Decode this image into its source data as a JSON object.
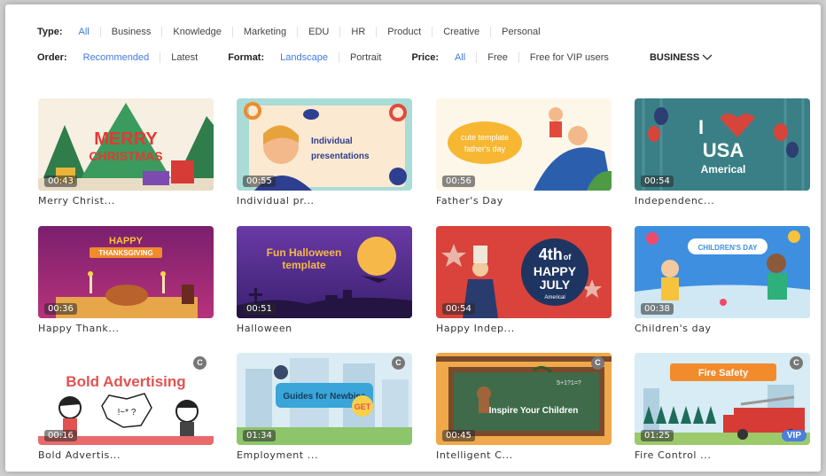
{
  "filters": {
    "type": {
      "label": "Type:",
      "options": [
        "All",
        "Business",
        "Knowledge",
        "Marketing",
        "EDU",
        "HR",
        "Product",
        "Creative",
        "Personal"
      ]
    },
    "order": {
      "label": "Order:",
      "options": [
        "Recommended",
        "Latest"
      ]
    },
    "format": {
      "label": "Format:",
      "options": [
        "Landscape",
        "Portrait"
      ]
    },
    "price": {
      "label": "Price:",
      "options": [
        "All",
        "Free",
        "Free for VIP users"
      ]
    },
    "category_dropdown": {
      "label": "BUSINESS",
      "icon": "chevron-down-icon"
    }
  },
  "colors": {
    "accent": "#3f7bdc",
    "vip": "#4a7ee0"
  },
  "templates": [
    {
      "title": "Merry Christ...",
      "duration": "00:43",
      "thumb_text": [
        "MERRY",
        "CHRISTMAS"
      ]
    },
    {
      "title": "Individual pr...",
      "duration": "00:55",
      "thumb_text": [
        "Individual",
        "presentations"
      ]
    },
    {
      "title": "Father's Day",
      "duration": "00:56",
      "thumb_text": [
        "cute template",
        "father's day"
      ]
    },
    {
      "title": "Independenc...",
      "duration": "00:54",
      "thumb_text": [
        "I",
        "USA",
        "Americal"
      ]
    },
    {
      "title": "Happy Thank...",
      "duration": "00:36",
      "thumb_text": [
        "HAPPY",
        "THANKSGIVING"
      ]
    },
    {
      "title": "Halloween",
      "duration": "00:51",
      "thumb_text": [
        "Fun Halloween",
        "template"
      ]
    },
    {
      "title": "Happy Indep...",
      "duration": "00:54",
      "thumb_text": [
        "4th",
        "of",
        "HAPPY",
        "JULY",
        "Americal"
      ]
    },
    {
      "title": "Children's day",
      "duration": "00:38",
      "thumb_text": [
        "CHILDREN'S DAY"
      ]
    },
    {
      "title": "Bold Advertis...",
      "duration": "00:16",
      "badge": "C",
      "thumb_text": [
        "Bold Advertising"
      ]
    },
    {
      "title": "Employment ...",
      "duration": "01:34",
      "badge": "C",
      "thumb_text": [
        "Guides for Newbies",
        "GET"
      ]
    },
    {
      "title": "Intelligent C...",
      "duration": "00:45",
      "badge": "C",
      "thumb_text": [
        "Inspire Your Children"
      ]
    },
    {
      "title": "Fire Control ...",
      "duration": "01:25",
      "badge": "C",
      "vip": "VIP",
      "thumb_text": [
        "Fire Safety"
      ]
    }
  ]
}
